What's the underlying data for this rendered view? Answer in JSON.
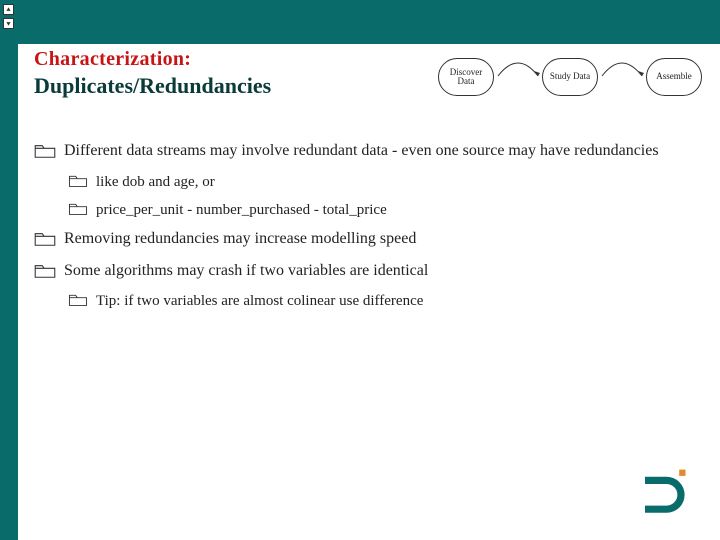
{
  "header": {
    "title_line1": "Characterization:",
    "title_line2": "Duplicates/Redundancies"
  },
  "workflow": {
    "nodes": [
      "Discover Data",
      "Study Data",
      "Assemble"
    ]
  },
  "bullets": {
    "b1": "Different data streams may involve redundant data - even one source may have redundancies",
    "b1a": "like dob and age, or",
    "b1b": "price_per_unit - number_purchased - total_price",
    "b2": "Removing redundancies may increase modelling speed",
    "b3": "Some algorithms  may crash if two variables are identical",
    "b3a": "Tip: if two variables are almost colinear use difference"
  },
  "icons": {
    "arrow_up": "arrow-up-icon",
    "arrow_down": "arrow-down-icon",
    "folder": "folder-icon",
    "logo": "brand-logo"
  },
  "colors": {
    "brand": "#0a6b6b",
    "accent_red": "#c81414",
    "accent_orange": "#e38a2a"
  }
}
